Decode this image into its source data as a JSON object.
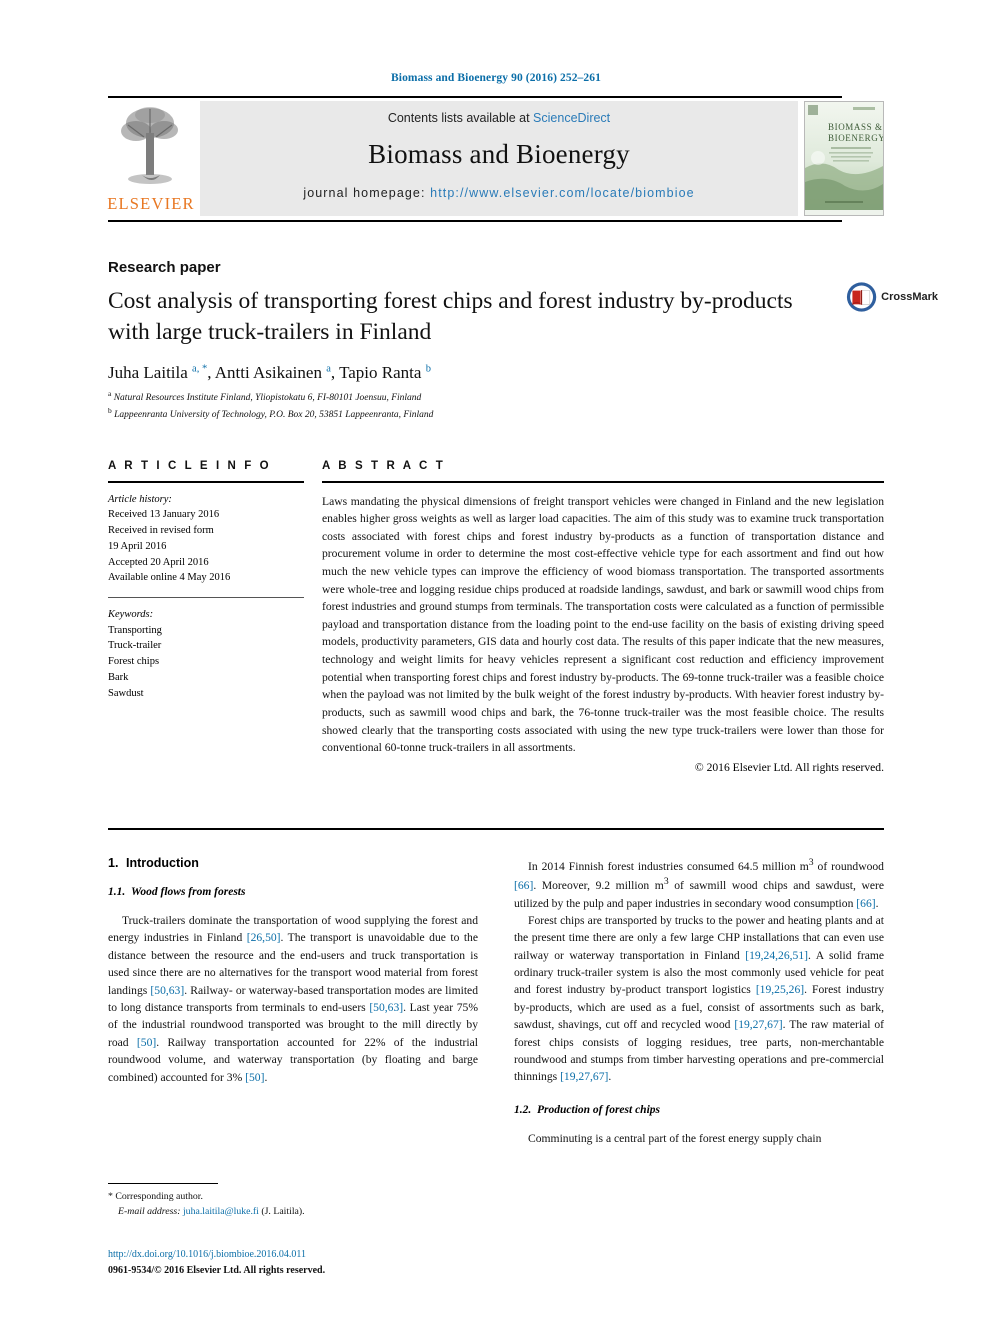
{
  "running_head": "Biomass and Bioenergy 90 (2016) 252–261",
  "masthead": {
    "contents_prefix": "Contents lists available at ",
    "contents_link": "ScienceDirect",
    "journal_name": "Biomass and Bioenergy",
    "homepage_label": "journal homepage:",
    "homepage_url": "http://www.elsevier.com/locate/biombioe",
    "publisher_logo_text": "ELSEVIER",
    "cover_title_line1": "BIOMASS &",
    "cover_title_line2": "BIOENERGY"
  },
  "article": {
    "category": "Research paper",
    "title": "Cost analysis of transporting forest chips and forest industry by-products with large truck-trailers in Finland",
    "crossmark_label": "CrossMark",
    "authors_html": "Juha Laitila <sup>a, *</sup>, Antti Asikainen <sup>a</sup>, Tapio Ranta <sup>b</sup>",
    "affiliations": [
      {
        "marker": "a",
        "text": "Natural Resources Institute Finland, Yliopistokatu 6, FI-80101 Joensuu, Finland"
      },
      {
        "marker": "b",
        "text": "Lappeenranta University of Technology, P.O. Box 20, 53851 Lappeenranta, Finland"
      }
    ]
  },
  "info": {
    "heading": "A R T I C L E   I N F O",
    "history_label": "Article history:",
    "history": [
      "Received 13 January 2016",
      "Received in revised form",
      "19 April 2016",
      "Accepted 20 April 2016",
      "Available online 4 May 2016"
    ],
    "keywords_label": "Keywords:",
    "keywords": [
      "Transporting",
      "Truck-trailer",
      "Forest chips",
      "Bark",
      "Sawdust"
    ]
  },
  "abstract": {
    "heading": "A B S T R A C T",
    "text": "Laws mandating the physical dimensions of freight transport vehicles were changed in Finland and the new legislation enables higher gross weights as well as larger load capacities. The aim of this study was to examine truck transportation costs associated with forest chips and forest industry by-products as a function of transportation distance and procurement volume in order to determine the most cost-effective vehicle type for each assortment and find out how much the new vehicle types can improve the efficiency of wood biomass transportation. The transported assortments were whole-tree and logging residue chips produced at roadside landings, sawdust, and bark or sawmill wood chips from forest industries and ground stumps from terminals. The transportation costs were calculated as a function of permissible payload and transportation distance from the loading point to the end-use facility on the basis of existing driving speed models, productivity parameters, GIS data and hourly cost data. The results of this paper indicate that the new measures, technology and weight limits for heavy vehicles represent a significant cost reduction and efficiency improvement potential when transporting forest chips and forest industry by-products. The 69-tonne truck-trailer was a feasible choice when the payload was not limited by the bulk weight of the forest industry by-products. With heavier forest industry by-products, such as sawmill wood chips and bark, the 76-tonne truck-trailer was the most feasible choice. The results showed clearly that the transporting costs associated with using the new type truck-trailers were lower than those for conventional 60-tonne truck-trailers in all assortments.",
    "copyright": "© 2016 Elsevier Ltd. All rights reserved."
  },
  "body": {
    "section1_num": "1.",
    "section1_title": "Introduction",
    "section11_num": "1.1.",
    "section11_title": "Wood flows from forests",
    "section12_num": "1.2.",
    "section12_title": "Production of forest chips",
    "left_paragraphs": [
      "Truck-trailers dominate the transportation of wood supplying the forest and energy industries in Finland [26,50]. The transport is unavoidable due to the distance between the resource and the end-users and truck transportation is used since there are no alternatives for the transport wood material from forest landings [50,63]. Railway- or waterway-based transportation modes are limited to long distance transports from terminals to end-users [50,63]. Last year 75% of the industrial roundwood transported was brought to the mill directly by road [50]. Railway transportation accounted for 22% of the industrial roundwood volume, and waterway transportation (by floating and barge combined) accounted for 3% [50]."
    ],
    "right_paragraphs": [
      "In 2014 Finnish forest industries consumed 64.5 million m³ of roundwood [66]. Moreover, 9.2 million m³ of sawmill wood chips and sawdust, were utilized by the pulp and paper industries in secondary wood consumption [66].",
      "Forest chips are transported by trucks to the power and heating plants and at the present time there are only a few large CHP installations that can even use railway or waterway transportation in Finland [19,24,26,51]. A solid frame ordinary truck-trailer system is also the most commonly used vehicle for peat and forest industry by-product transport logistics [19,25,26]. Forest industry by-products, which are used as a fuel, consist of assortments such as bark, sawdust, shavings, cut off and recycled wood [19,27,67]. The raw material of forest chips consists of logging residues, tree parts, non-merchantable roundwood and stumps from timber harvesting operations and pre-commercial thinnings [19,27,67].",
      "Comminuting is a central part of the forest energy supply chain"
    ]
  },
  "footer": {
    "corresponding_marker": "*",
    "corresponding_label": "Corresponding author.",
    "email_label": "E-mail address:",
    "email": "juha.laitila@luke.fi",
    "email_suffix": "(J. Laitila).",
    "doi_url": "http://dx.doi.org/10.1016/j.biombioe.2016.04.011",
    "issn_line": "0961-9534/© 2016 Elsevier Ltd. All rights reserved."
  },
  "colors": {
    "link": "#0b6ea8",
    "elsevier_orange": "#e87722",
    "masthead_grey": "#e9e9e9"
  }
}
